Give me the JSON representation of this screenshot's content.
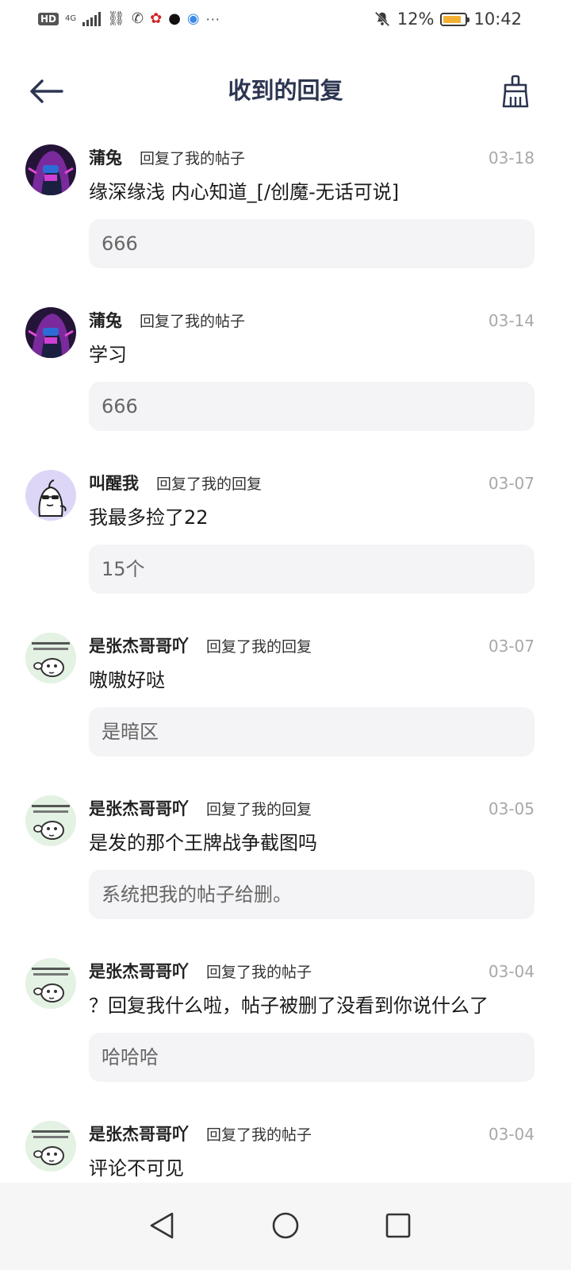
{
  "status_bar": {
    "hd": "HD",
    "network": "4G",
    "battery_percent": "12%",
    "time": "10:42"
  },
  "header": {
    "title": "收到的回复",
    "back_icon": "arrow-left-icon",
    "clear_icon": "broom-icon"
  },
  "replies": [
    {
      "user": "蒲兔",
      "action": "回复了我的帖子",
      "date": "03-18",
      "content": "缘深缘浅   内心知道_[/创魔-无话可说]",
      "quote": "666",
      "avatar": "avatar-purple-hood"
    },
    {
      "user": "蒲兔",
      "action": "回复了我的帖子",
      "date": "03-14",
      "content": "学习",
      "quote": "666",
      "avatar": "avatar-purple-hood"
    },
    {
      "user": "叫醒我",
      "action": "回复了我的回复",
      "date": "03-07",
      "content": "我最多捡了22",
      "quote": "15个",
      "avatar": "avatar-cartoon-face"
    },
    {
      "user": "是张杰哥哥吖",
      "action": "回复了我的回复",
      "date": "03-07",
      "content": "嗷嗷好哒",
      "quote": "是暗区",
      "avatar": "avatar-sticker"
    },
    {
      "user": "是张杰哥哥吖",
      "action": "回复了我的回复",
      "date": "03-05",
      "content": "是发的那个王牌战争截图吗",
      "quote": "系统把我的帖子给删。",
      "avatar": "avatar-sticker"
    },
    {
      "user": "是张杰哥哥吖",
      "action": "回复了我的帖子",
      "date": "03-04",
      "content": "？回复我什么啦，帖子被删了没看到你说什么了",
      "quote": "哈哈哈",
      "avatar": "avatar-sticker"
    },
    {
      "user": "是张杰哥哥吖",
      "action": "回复了我的帖子",
      "date": "03-04",
      "content": "评论不可见",
      "quote": "",
      "avatar": "avatar-sticker"
    }
  ],
  "navbar": {
    "back": "triangle-back-icon",
    "home": "circle-home-icon",
    "recents": "square-recents-icon"
  }
}
